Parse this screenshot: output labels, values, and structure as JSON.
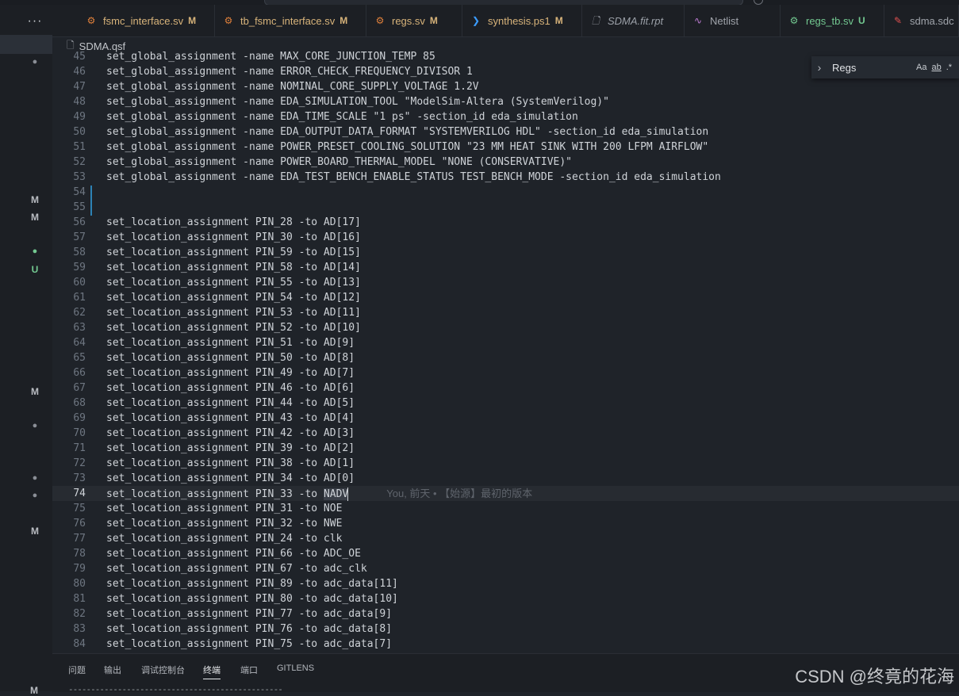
{
  "tabs": [
    {
      "label": "fsmc_interface.sv",
      "badge": "M",
      "kind": "sv"
    },
    {
      "label": "tb_fsmc_interface.sv",
      "badge": "M",
      "kind": "sv"
    },
    {
      "label": "regs.sv",
      "badge": "M",
      "kind": "sv"
    },
    {
      "label": "synthesis.ps1",
      "badge": "M",
      "kind": "ps"
    },
    {
      "label": "SDMA.fit.rpt",
      "badge": "",
      "kind": "doc"
    },
    {
      "label": "Netlist",
      "badge": "",
      "kind": "net"
    },
    {
      "label": "regs_tb.sv",
      "badge": "U",
      "kind": "new"
    },
    {
      "label": "sdma.sdc",
      "badge": "",
      "kind": "sdc"
    }
  ],
  "breadcrumb": {
    "file": "SDMA.qsf"
  },
  "find": {
    "query": "Regs",
    "opt_case": "Aa",
    "opt_word": "ab",
    "opt_regex": ".*"
  },
  "editor": {
    "lines": [
      {
        "n": "45",
        "t": "set_global_assignment -name MAX_CORE_JUNCTION_TEMP 85"
      },
      {
        "n": "46",
        "t": "set_global_assignment -name ERROR_CHECK_FREQUENCY_DIVISOR 1"
      },
      {
        "n": "47",
        "t": "set_global_assignment -name NOMINAL_CORE_SUPPLY_VOLTAGE 1.2V"
      },
      {
        "n": "48",
        "t": "set_global_assignment -name EDA_SIMULATION_TOOL \"ModelSim-Altera (SystemVerilog)\""
      },
      {
        "n": "49",
        "t": "set_global_assignment -name EDA_TIME_SCALE \"1 ps\" -section_id eda_simulation"
      },
      {
        "n": "50",
        "t": "set_global_assignment -name EDA_OUTPUT_DATA_FORMAT \"SYSTEMVERILOG HDL\" -section_id eda_simulation"
      },
      {
        "n": "51",
        "t": "set_global_assignment -name POWER_PRESET_COOLING_SOLUTION \"23 MM HEAT SINK WITH 200 LFPM AIRFLOW\""
      },
      {
        "n": "52",
        "t": "set_global_assignment -name POWER_BOARD_THERMAL_MODEL \"NONE (CONSERVATIVE)\""
      },
      {
        "n": "53",
        "t": "set_global_assignment -name EDA_TEST_BENCH_ENABLE_STATUS TEST_BENCH_MODE -section_id eda_simulation"
      },
      {
        "n": "54",
        "t": ""
      },
      {
        "n": "55",
        "t": ""
      },
      {
        "n": "56",
        "t": "set_location_assignment PIN_28 -to AD[17]"
      },
      {
        "n": "57",
        "t": "set_location_assignment PIN_30 -to AD[16]"
      },
      {
        "n": "58",
        "t": "set_location_assignment PIN_59 -to AD[15]"
      },
      {
        "n": "59",
        "t": "set_location_assignment PIN_58 -to AD[14]"
      },
      {
        "n": "60",
        "t": "set_location_assignment PIN_55 -to AD[13]"
      },
      {
        "n": "61",
        "t": "set_location_assignment PIN_54 -to AD[12]"
      },
      {
        "n": "62",
        "t": "set_location_assignment PIN_53 -to AD[11]"
      },
      {
        "n": "63",
        "t": "set_location_assignment PIN_52 -to AD[10]"
      },
      {
        "n": "64",
        "t": "set_location_assignment PIN_51 -to AD[9]"
      },
      {
        "n": "65",
        "t": "set_location_assignment PIN_50 -to AD[8]"
      },
      {
        "n": "66",
        "t": "set_location_assignment PIN_49 -to AD[7]"
      },
      {
        "n": "67",
        "t": "set_location_assignment PIN_46 -to AD[6]"
      },
      {
        "n": "68",
        "t": "set_location_assignment PIN_44 -to AD[5]"
      },
      {
        "n": "69",
        "t": "set_location_assignment PIN_43 -to AD[4]"
      },
      {
        "n": "70",
        "t": "set_location_assignment PIN_42 -to AD[3]"
      },
      {
        "n": "71",
        "t": "set_location_assignment PIN_39 -to AD[2]"
      },
      {
        "n": "72",
        "t": "set_location_assignment PIN_38 -to AD[1]"
      },
      {
        "n": "73",
        "t": "set_location_assignment PIN_34 -to AD[0]"
      },
      {
        "n": "74",
        "t": "set_location_assignment PIN_33 -to ",
        "hl": "NADV",
        "blame": "You, 前天 • 【始源】最初的版本"
      },
      {
        "n": "75",
        "t": "set_location_assignment PIN_31 -to NOE"
      },
      {
        "n": "76",
        "t": "set_location_assignment PIN_32 -to NWE"
      },
      {
        "n": "77",
        "t": "set_location_assignment PIN_24 -to clk"
      },
      {
        "n": "78",
        "t": "set_location_assignment PIN_66 -to ADC_OE"
      },
      {
        "n": "79",
        "t": "set_location_assignment PIN_67 -to adc_clk"
      },
      {
        "n": "80",
        "t": "set_location_assignment PIN_89 -to adc_data[11]"
      },
      {
        "n": "81",
        "t": "set_location_assignment PIN_80 -to adc_data[10]"
      },
      {
        "n": "82",
        "t": "set_location_assignment PIN_77 -to adc_data[9]"
      },
      {
        "n": "83",
        "t": "set_location_assignment PIN_76 -to adc_data[8]"
      },
      {
        "n": "84",
        "t": "set_location_assignment PIN_75 -to adc_data[7]"
      }
    ]
  },
  "sidebar_markers": [
    {
      "label": "●",
      "kind": "dot"
    },
    {
      "label": "M",
      "kind": "m"
    },
    {
      "label": "M",
      "kind": "m"
    },
    {
      "label": "●",
      "kind": "dot green"
    },
    {
      "label": "U",
      "kind": "u"
    },
    {
      "label": "M",
      "kind": "m"
    },
    {
      "label": "●",
      "kind": "dot"
    },
    {
      "label": "●",
      "kind": "dot"
    },
    {
      "label": "●",
      "kind": "dot"
    },
    {
      "label": "M",
      "kind": "m"
    }
  ],
  "panel": {
    "tabs": [
      "问题",
      "输出",
      "调试控制台",
      "终端",
      "端口",
      "GITLENS"
    ],
    "active": "终端",
    "dashes": "------------------------------------------------"
  },
  "watermark": "CSDN @终竟的花海",
  "bottom_marker": "M"
}
